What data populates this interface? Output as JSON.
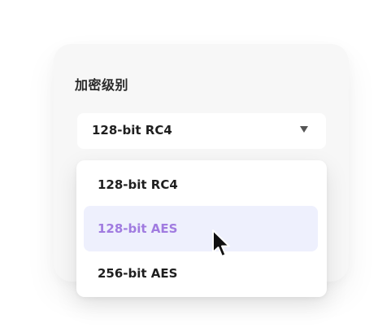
{
  "field": {
    "label": "加密级别",
    "selected_value": "128-bit RC4"
  },
  "dropdown": {
    "options": [
      {
        "label": "128-bit RC4"
      },
      {
        "label": "128-bit AES",
        "state": "hovered"
      },
      {
        "label": "256-bit AES"
      }
    ]
  },
  "colors": {
    "hover_background": "#eef0fd",
    "hover_text": "#a07be0",
    "card_background": "#f7f7f7"
  },
  "icons": {
    "caret": "caret-down-icon",
    "pointer": "mouse-pointer-icon"
  }
}
